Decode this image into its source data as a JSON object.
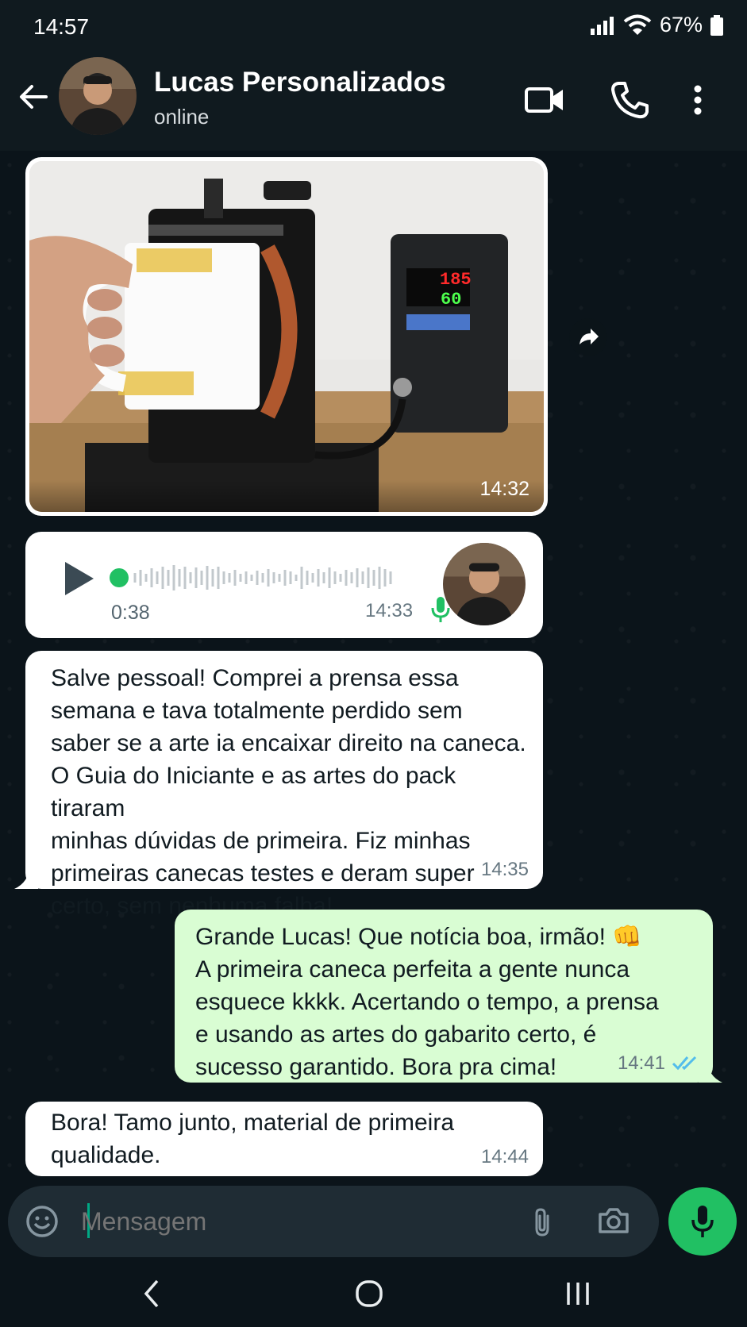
{
  "status_bar": {
    "time": "14:57",
    "battery": "67%",
    "icons": [
      "signal-icon",
      "wifi-icon",
      "battery-icon"
    ]
  },
  "header": {
    "contact_name": "Lucas Personalizados",
    "contact_status": "online",
    "icons": [
      "back-arrow-icon",
      "video-call-icon",
      "phone-icon",
      "more-vert-icon"
    ]
  },
  "messages": [
    {
      "type": "image",
      "direction": "in",
      "time": "14:32",
      "display_readings": [
        "185",
        "60"
      ]
    },
    {
      "type": "audio",
      "direction": "in",
      "duration": "0:38",
      "time": "14:33"
    },
    {
      "type": "text",
      "direction": "in",
      "time": "14:35",
      "lines": [
        "Salve pessoal! Comprei a prensa essa",
        "semana e tava totalmente perdido sem",
        "saber se a arte ia encaixar direito na caneca.",
        "O Guia do Iniciante e as artes do pack tiraram",
        "minhas dúvidas de primeira. Fiz minhas",
        "primeiras canecas testes e deram super",
        "certo, sem nenhuma falha!"
      ]
    },
    {
      "type": "text",
      "direction": "out",
      "time": "14:41",
      "status": "read",
      "lines": [
        "Grande Lucas! Que notícia boa, irmão! 👊",
        "A primeira caneca perfeita a gente nunca",
        "esquece kkkk. Acertando o tempo, a prensa",
        "e usando as artes do gabarito certo, é",
        "sucesso garantido. Bora pra cima!"
      ]
    },
    {
      "type": "text",
      "direction": "in",
      "time": "14:44",
      "lines": [
        "Bora! Tamo junto, material de primeira",
        "qualidade."
      ]
    }
  ],
  "composer": {
    "placeholder": "Mensagem",
    "icons": [
      "emoji-icon",
      "attach-icon",
      "camera-icon",
      "mic-icon"
    ]
  },
  "colors": {
    "background": "#0b141a",
    "incoming_bubble": "#ffffff",
    "outgoing_bubble": "#d9fdd3",
    "accent_green": "#21c063",
    "read_tick": "#53bdeb"
  }
}
